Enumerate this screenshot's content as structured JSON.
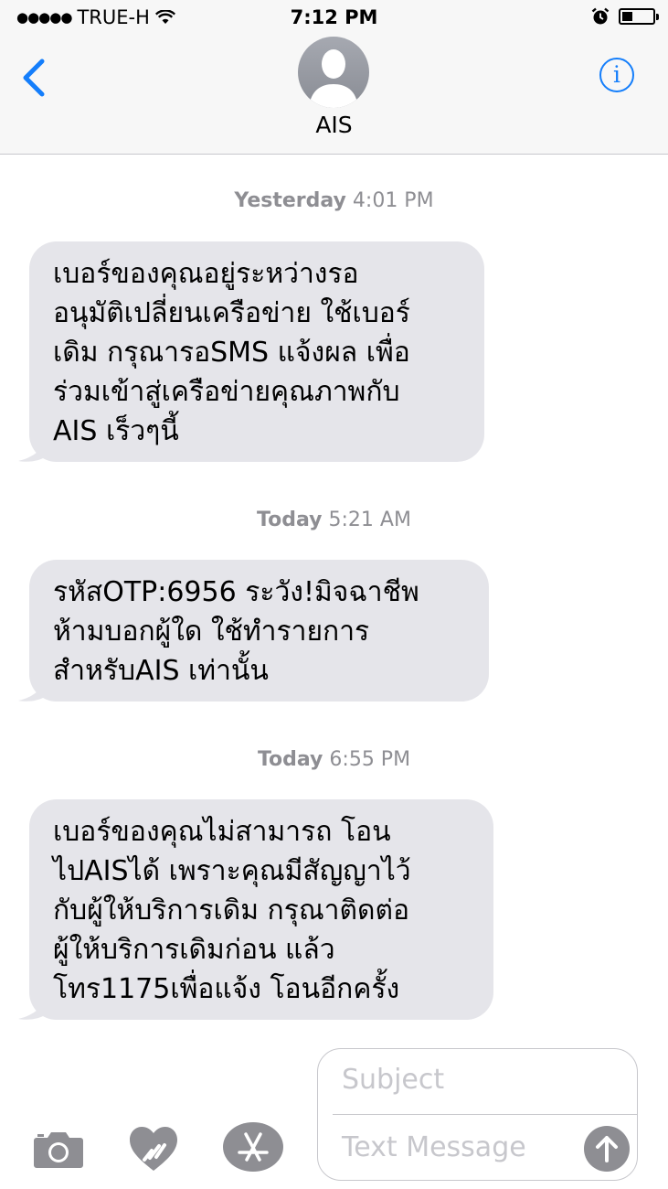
{
  "status_bar": {
    "carrier": "TRUE-H",
    "time": "7:12 PM",
    "battery_level": 0.35
  },
  "nav": {
    "contact_name": "AIS",
    "info_label": "i",
    "accent_color": "#147efb"
  },
  "messages": [
    {
      "day": "Yesterday",
      "time": "4:01 PM",
      "lines": [
        "เบอร์ของคุณอยู่ระหว่างรอ",
        "อนุมัติเปลี่ยนเครือข่าย ใช้เบอร์",
        "เดิม กรุณารอSMS แจ้งผล เพื่อ",
        "ร่วมเข้าสู่เครือข่ายคุณภาพกับ",
        "AIS เร็วๆนี้"
      ]
    },
    {
      "day": "Today",
      "time": "5:21 AM",
      "lines": [
        "รหัสOTP:6956 ระวัง!มิจฉาชีพ",
        "ห้ามบอกผู้ใด  ใช้ทำรายการ",
        "สำหรับAIS เท่านั้น"
      ]
    },
    {
      "day": "Today",
      "time": "6:55 PM",
      "lines": [
        "เบอร์ของคุณไม่สามารถ โอน",
        "ไปAISได้ เพราะคุณมีสัญญาไว้",
        "กับผู้ให้บริการเดิม กรุณาติดต่อ",
        "ผู้ให้บริการเดิมก่อน แล้ว",
        "โทร1175เพื่อแจ้ง โอนอีกครั้ง"
      ]
    }
  ],
  "compose": {
    "subject_placeholder": "Subject",
    "message_placeholder": "Text Message"
  },
  "icons": {
    "back": "chevron-left-icon",
    "info": "info-icon",
    "camera": "camera-icon",
    "digital_touch": "digital-touch-icon",
    "app_store": "app-store-icon",
    "send": "send-arrow-icon"
  }
}
